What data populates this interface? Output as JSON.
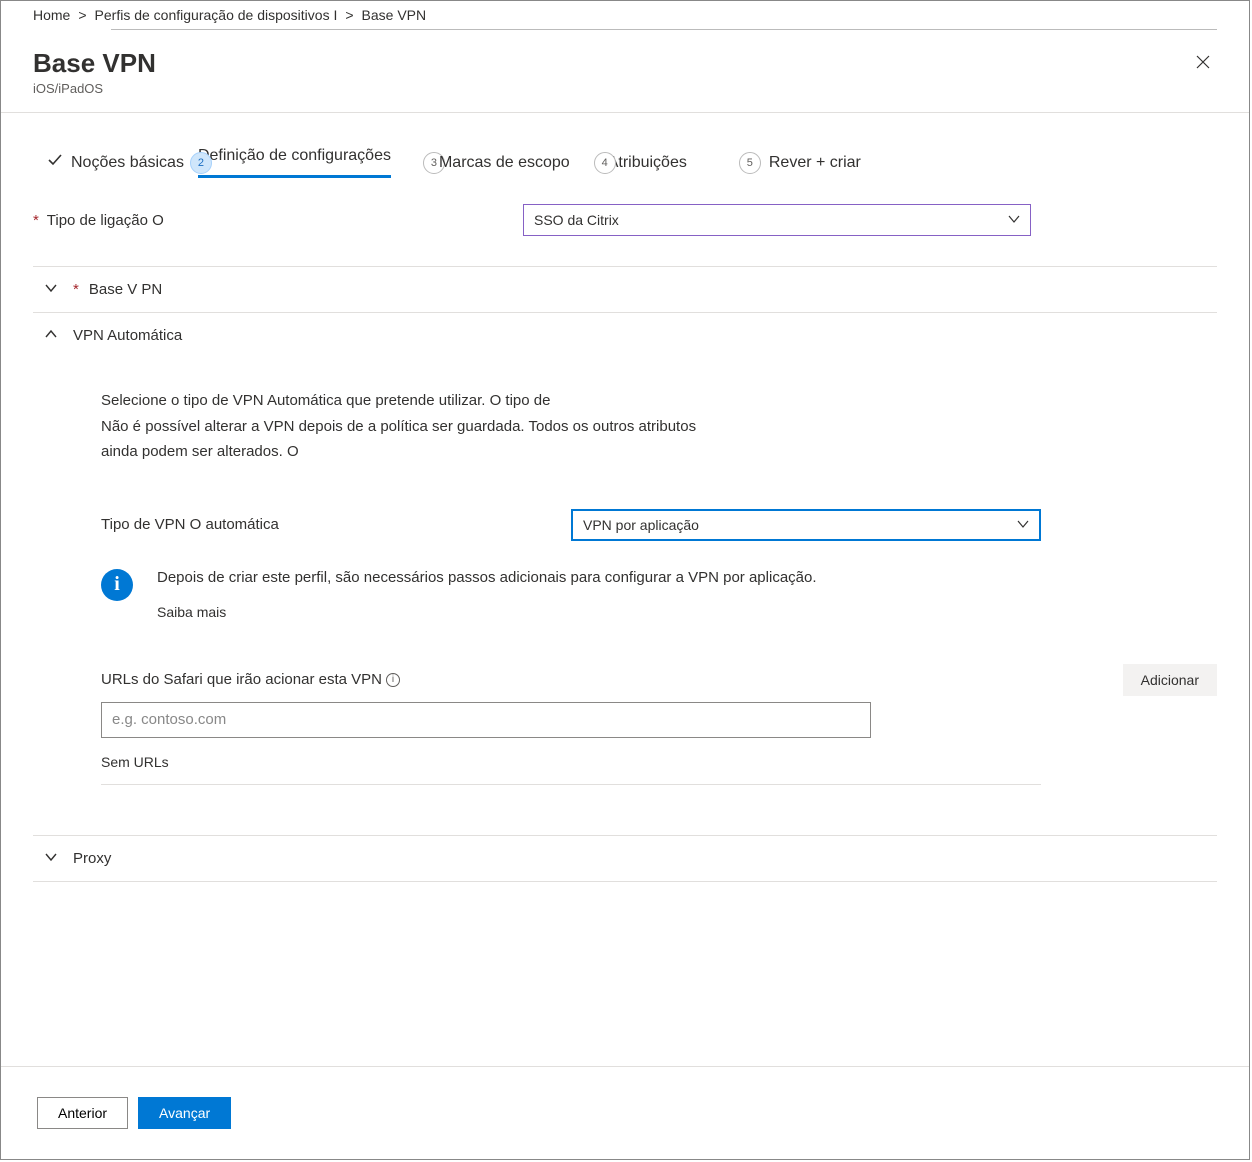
{
  "breadcrumb": {
    "items": [
      "Home",
      "Perfis de configuração de dispositivos I",
      "Base VPN"
    ],
    "separator": ">"
  },
  "header": {
    "title": "Base VPN",
    "subtitle": "iOS/iPadOS"
  },
  "steps": {
    "s1": {
      "label": "Noções básicas"
    },
    "s2": {
      "label": "Definição de configurações",
      "badge": "2"
    },
    "s3": {
      "label": "Marcas de escopo",
      "badge": "3"
    },
    "s4": {
      "label": "Atribuições",
      "badge": "4"
    },
    "s5": {
      "label": "Rever + criar",
      "badge": "5"
    }
  },
  "fields": {
    "connection_type_label": "Tipo de ligação O",
    "connection_type_value": "SSO da Citrix"
  },
  "sections": {
    "base_vpn": "Base V PN",
    "auto_vpn": "VPN Automática",
    "proxy": "Proxy"
  },
  "auto_vpn": {
    "desc_line1": "Selecione o tipo de VPN Automática que pretende utilizar. O tipo de",
    "desc_line2": "Não é possível alterar a VPN depois de a política ser guardada. Todos os outros atributos",
    "desc_line3": "ainda podem ser alterados. O",
    "type_label": "Tipo de VPN O automática",
    "type_value": "VPN por aplicação",
    "info_text": "Depois de criar este perfil, são necessários passos adicionais para configurar a VPN por aplicação.",
    "learn_more": "Saiba mais",
    "safari_label": "URLs do Safari que irão acionar esta VPN",
    "add_btn": "Adicionar",
    "safari_placeholder": "e.g. contoso.com",
    "no_urls": "Sem URLs"
  },
  "footer": {
    "prev": "Anterior",
    "next": "Avançar"
  }
}
